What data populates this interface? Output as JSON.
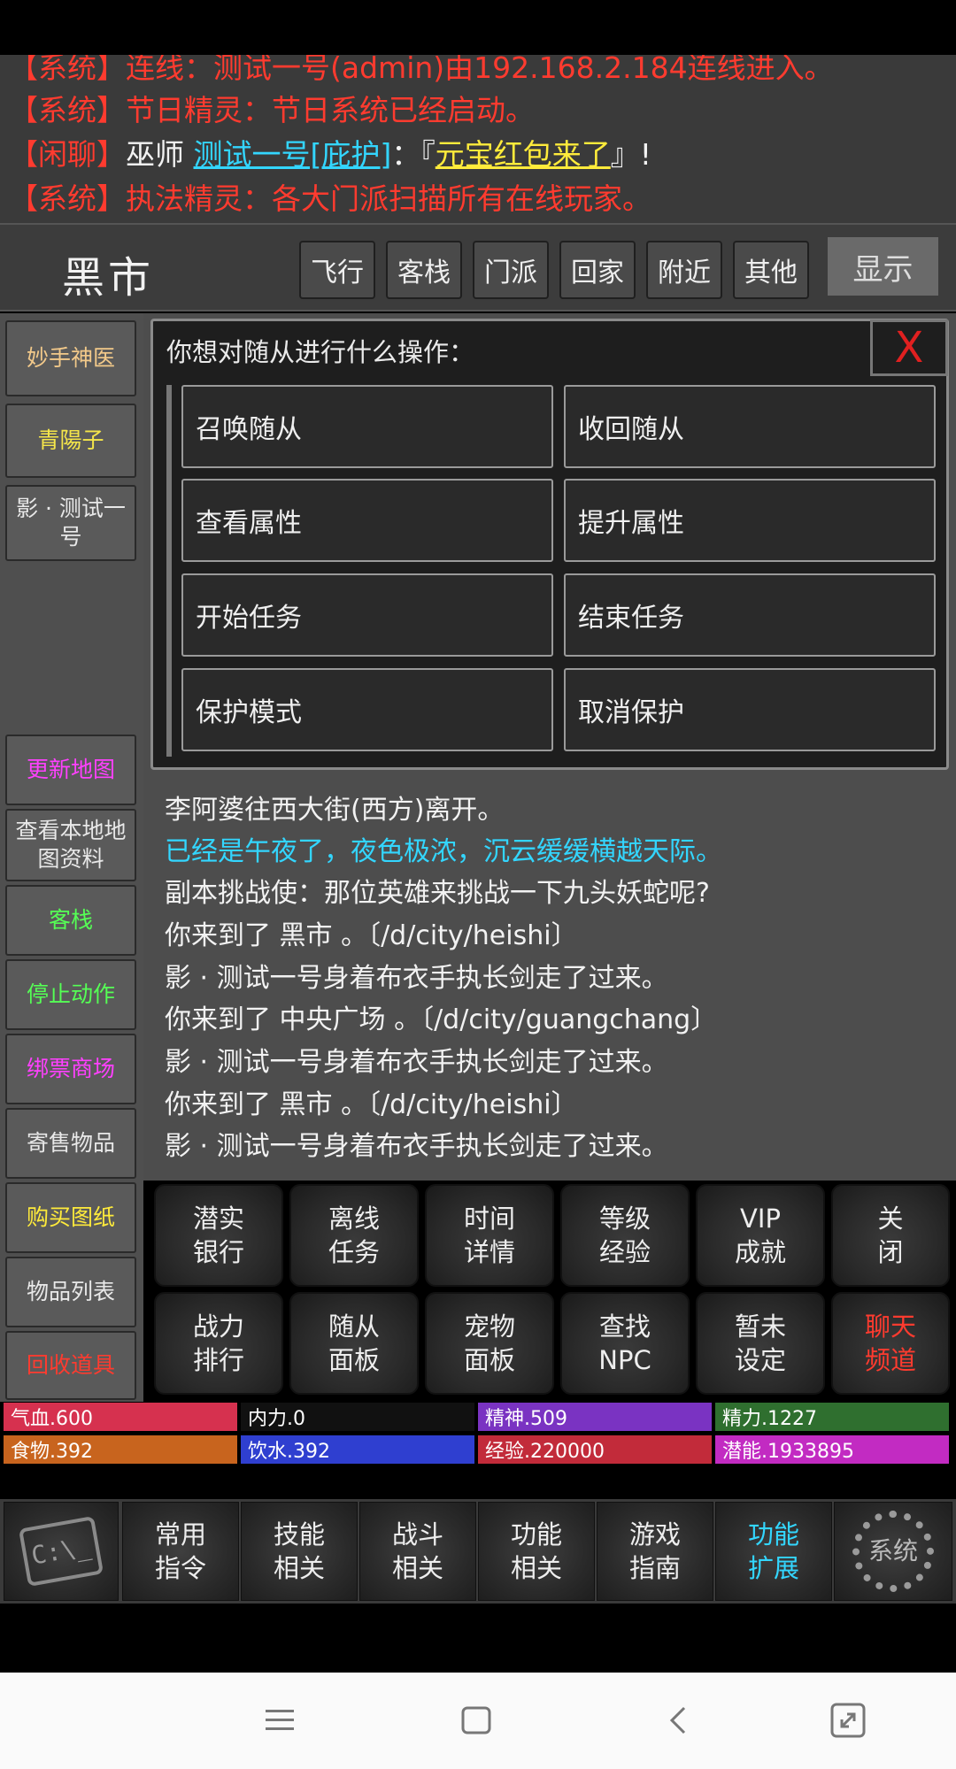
{
  "log": [
    {
      "tag": "【系统】",
      "speaker": "连线：",
      "body": "测试一号(admin)由192.168.2.184连线进入。"
    },
    {
      "tag": "【系统】",
      "speaker": "节日精灵：",
      "body": "节日系统已经启动。"
    },
    {
      "tag": "【闲聊】",
      "speaker": "巫师 ",
      "link": "测试一号[庇护]",
      "colon": "：『",
      "reward": "元宝红包来了",
      "end": "』!"
    },
    {
      "tag": "【系统】",
      "speaker": "执法精灵：",
      "body": "各大门派扫描所有在线玩家。"
    }
  ],
  "location": {
    "title": "黑市"
  },
  "nav_buttons": [
    "飞行",
    "客栈",
    "门派",
    "回家",
    "附近",
    "其他"
  ],
  "show_button": "显示",
  "left_menu_top": [
    {
      "label": "妙手神医",
      "color": "#f2c98a"
    },
    {
      "label": "青陽子",
      "color": "#f5e64a"
    },
    {
      "label": "影 · 测试一号",
      "color": "#e8e8e8"
    }
  ],
  "left_menu_bottom": [
    {
      "label": "更新地图",
      "color": "#ff40ff"
    },
    {
      "label": "查看本地地图资料",
      "color": "#e8e8e8"
    },
    {
      "label": "客栈",
      "color": "#55ff55"
    },
    {
      "label": "停止动作",
      "color": "#55ff55"
    },
    {
      "label": "绑票商场",
      "color": "#ff40ff"
    },
    {
      "label": "寄售物品",
      "color": "#e8e8e8"
    },
    {
      "label": "购买图纸",
      "color": "#ffeb3b"
    },
    {
      "label": "物品列表",
      "color": "#e8e8e8"
    },
    {
      "label": "回收道具",
      "color": "#ff3b2f"
    }
  ],
  "dialog": {
    "title": "你想对随从进行什么操作：",
    "close": "X",
    "options": [
      "召唤随从",
      "收回随从",
      "查看属性",
      "提升属性",
      "开始任务",
      "结束任务",
      "保护模式",
      "取消保护"
    ]
  },
  "messages": [
    {
      "text": "李阿婆往西大街(西方)离开。",
      "color": "#f2f2f2"
    },
    {
      "text": "已经是午夜了，夜色极浓，沉云缓缓横越天际。",
      "color": "#33d6ff"
    },
    {
      "text": "副本挑战使：那位英雄来挑战一下九头妖蛇呢?",
      "color": "#f2f2f2"
    },
    {
      "text": "你来到了 黑市 。〔/d/city/heishi〕",
      "color": "#f2f2f2"
    },
    {
      "text": "影 · 测试一号身着布衣手执长剑走了过来。",
      "color": "#f2f2f2"
    },
    {
      "text": "你来到了 中央广场 。〔/d/city/guangchang〕",
      "color": "#f2f2f2"
    },
    {
      "text": "影 · 测试一号身着布衣手执长剑走了过来。",
      "color": "#f2f2f2"
    },
    {
      "text": "你来到了 黑市 。〔/d/city/heishi〕",
      "color": "#f2f2f2"
    },
    {
      "text": "影 · 测试一号身着布衣手执长剑走了过来。",
      "color": "#f2f2f2"
    }
  ],
  "func_row1": [
    {
      "l1": "潜实",
      "l2": "银行"
    },
    {
      "l1": "离线",
      "l2": "任务"
    },
    {
      "l1": "时间",
      "l2": "详情"
    },
    {
      "l1": "等级",
      "l2": "经验"
    },
    {
      "l1": "VIP",
      "l2": "成就"
    },
    {
      "l1": "关",
      "l2": "闭"
    }
  ],
  "func_row2": [
    {
      "l1": "战力",
      "l2": "排行"
    },
    {
      "l1": "随从",
      "l2": "面板"
    },
    {
      "l1": "宠物",
      "l2": "面板"
    },
    {
      "l1": "查找",
      "l2": "NPC"
    },
    {
      "l1": "暂未",
      "l2": "设定"
    },
    {
      "l1": "聊天",
      "l2": "频道"
    }
  ],
  "stats": [
    {
      "label": "气血.600",
      "color": "#d6314f"
    },
    {
      "label": "内力.0",
      "color": "#111111"
    },
    {
      "label": "精神.509",
      "color": "#7a33c2"
    },
    {
      "label": "精力.1227",
      "color": "#2f6f2f"
    },
    {
      "label": "食物.392",
      "color": "#c8641e"
    },
    {
      "label": "饮水.392",
      "color": "#2f3fd0"
    },
    {
      "label": "经验.220000",
      "color": "#c22b3a"
    },
    {
      "label": "潜能.1933895",
      "color": "#c22bc2"
    }
  ],
  "toolbar": [
    {
      "l1": "常用",
      "l2": "指令"
    },
    {
      "l1": "技能",
      "l2": "相关"
    },
    {
      "l1": "战斗",
      "l2": "相关"
    },
    {
      "l1": "功能",
      "l2": "相关"
    },
    {
      "l1": "游戏",
      "l2": "指南"
    },
    {
      "l1": "功能",
      "l2": "扩展"
    }
  ],
  "toolbar_left": "C:\\_",
  "toolbar_right": "系统"
}
